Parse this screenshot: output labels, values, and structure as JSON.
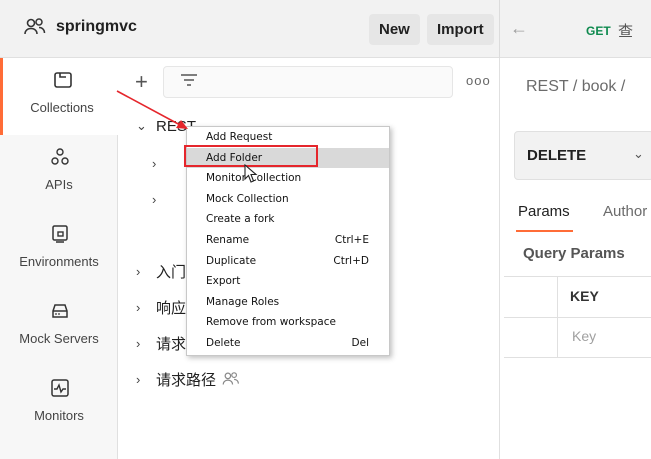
{
  "header": {
    "workspace_name": "springmvc",
    "new_label": "New",
    "import_label": "Import",
    "tab_method": "GET",
    "tab_name": "查"
  },
  "leftnav": {
    "items": [
      {
        "label": "Collections",
        "icon": "collections-icon",
        "active": true
      },
      {
        "label": "APIs",
        "icon": "apis-icon"
      },
      {
        "label": "Environments",
        "icon": "environments-icon"
      },
      {
        "label": "Mock Servers",
        "icon": "mock-servers-icon"
      },
      {
        "label": "Monitors",
        "icon": "monitors-icon"
      }
    ]
  },
  "toolbar": {
    "add_icon": "plus-icon",
    "filter_icon": "filter-icon",
    "more_label": "ooo"
  },
  "tree": {
    "items": [
      {
        "label": "REST",
        "expanded": true
      },
      {
        "label": "",
        "expanded": false
      },
      {
        "label": "",
        "expanded": false
      },
      {
        "label": "入门",
        "expanded": false
      },
      {
        "label": "响应",
        "expanded": false
      },
      {
        "label": "请求",
        "expanded": false
      },
      {
        "label": "请求路径",
        "expanded": false
      }
    ]
  },
  "context_menu": {
    "items": [
      {
        "label": "Add Request",
        "shortcut": ""
      },
      {
        "label": "Add Folder",
        "shortcut": "",
        "highlighted": true
      },
      {
        "label": "Monitor Collection",
        "shortcut": ""
      },
      {
        "label": "Mock Collection",
        "shortcut": ""
      },
      {
        "label": "Create a fork",
        "shortcut": ""
      },
      {
        "label": "Rename",
        "shortcut": "Ctrl+E"
      },
      {
        "label": "Duplicate",
        "shortcut": "Ctrl+D"
      },
      {
        "label": "Export",
        "shortcut": ""
      },
      {
        "label": "Manage Roles",
        "shortcut": ""
      },
      {
        "label": "Remove from workspace",
        "shortcut": ""
      },
      {
        "label": "Delete",
        "shortcut": "Del"
      }
    ]
  },
  "request": {
    "breadcrumb": "REST / book / ",
    "method": "DELETE",
    "tabs": [
      "Params",
      "Author"
    ],
    "active_tab": "Params",
    "section_title": "Query Params",
    "table_header_key": "KEY",
    "key_placeholder": "Key"
  },
  "colors": {
    "accent": "#ff6c37",
    "highlight_box": "#e5262c",
    "get_method": "#0f8a4f"
  }
}
